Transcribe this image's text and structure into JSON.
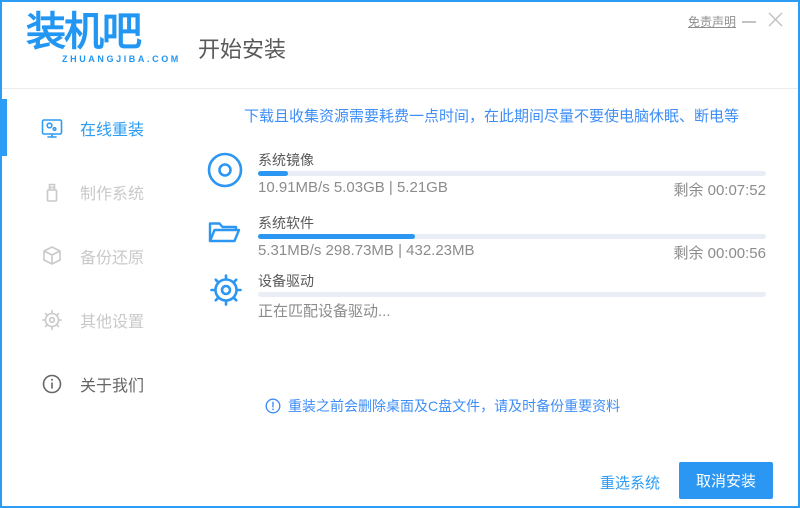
{
  "header": {
    "logo_text": "装机吧",
    "logo_sub": "ZHUANGJIBA.COM",
    "title": "开始安装",
    "disclaimer_label": "免责声明"
  },
  "sidebar": {
    "items": [
      {
        "label": "在线重装",
        "icon": "monitor-icon",
        "active": true
      },
      {
        "label": "制作系统",
        "icon": "usb-icon",
        "active": false
      },
      {
        "label": "备份还原",
        "icon": "backup-icon",
        "active": false
      },
      {
        "label": "其他设置",
        "icon": "gear-icon",
        "active": false
      },
      {
        "label": "关于我们",
        "icon": "info-icon",
        "active": false
      }
    ]
  },
  "main": {
    "notice": "下载且收集资源需要耗费一点时间，在此期间尽量不要使电脑休眠、断电等",
    "tasks": [
      {
        "name": "系统镜像",
        "percent": 6,
        "stats": "10.91MB/s 5.03GB | 5.21GB",
        "remaining": "剩余 00:07:52"
      },
      {
        "name": "系统软件",
        "percent": 31,
        "stats": "5.31MB/s 298.73MB | 432.23MB",
        "remaining": "剩余 00:00:56"
      },
      {
        "name": "设备驱动",
        "percent": 0,
        "stats": "正在匹配设备驱动...",
        "remaining": ""
      }
    ],
    "warning": "重装之前会删除桌面及C盘文件，请及时备份重要资料"
  },
  "footer": {
    "reselect_label": "重选系统",
    "cancel_label": "取消安装"
  },
  "colors": {
    "accent": "#2b97f3",
    "border": "#2d9cf4",
    "notice_text": "#3e8ef7",
    "track": "#e9eef6",
    "inactive_gray": "#c9c9c9"
  }
}
